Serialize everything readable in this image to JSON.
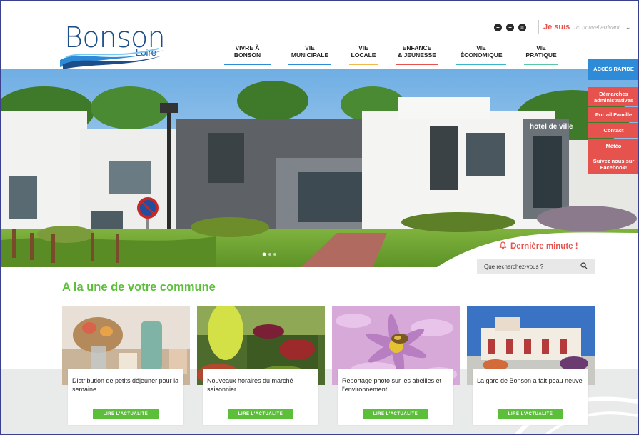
{
  "header": {
    "logo": {
      "name": "Bonson",
      "sub": "Loire"
    },
    "a11y": [
      "+",
      "−",
      "="
    ],
    "jesuis_label": "Je suis",
    "jesuis_value": "un nouvel arrivant",
    "nav": [
      {
        "label": "VIVRE À\nBONSON"
      },
      {
        "label": "VIE\nMUNICIPALE"
      },
      {
        "label": "VIE\nLOCALE"
      },
      {
        "label": "ENFANCE\n& JEUNESSE"
      },
      {
        "label": "VIE\nÉCONOMIQUE"
      },
      {
        "label": "VIE\nPRATIQUE"
      }
    ]
  },
  "hero": {
    "building_sign": "hotel de ville"
  },
  "quick_access": {
    "title": "ACCÈS RAPIDE",
    "items": [
      "Démarches\nadministratives",
      "Portail Famille",
      "Contact",
      "Météo",
      "Suivez nous sur\nFacebook!"
    ]
  },
  "dernier": "Dernière minute !",
  "search": {
    "placeholder": "Que recherchez-vous ?"
  },
  "news": {
    "title": "A la une de votre commune",
    "button_label": "LIRE L'ACTUALITÉ",
    "cards": [
      {
        "title": "Distribution de petits déjeuner pour la semaine ..."
      },
      {
        "title": "Nouveaux horaires du marché saisonnier"
      },
      {
        "title": "Reportage photo sur les abeilles et l'environnement"
      },
      {
        "title": "La gare de Bonson a fait peau neuve"
      }
    ]
  },
  "colors": {
    "accent_blue": "#2d8bd8",
    "accent_red": "#e6534f",
    "accent_green": "#5cbf3a"
  }
}
